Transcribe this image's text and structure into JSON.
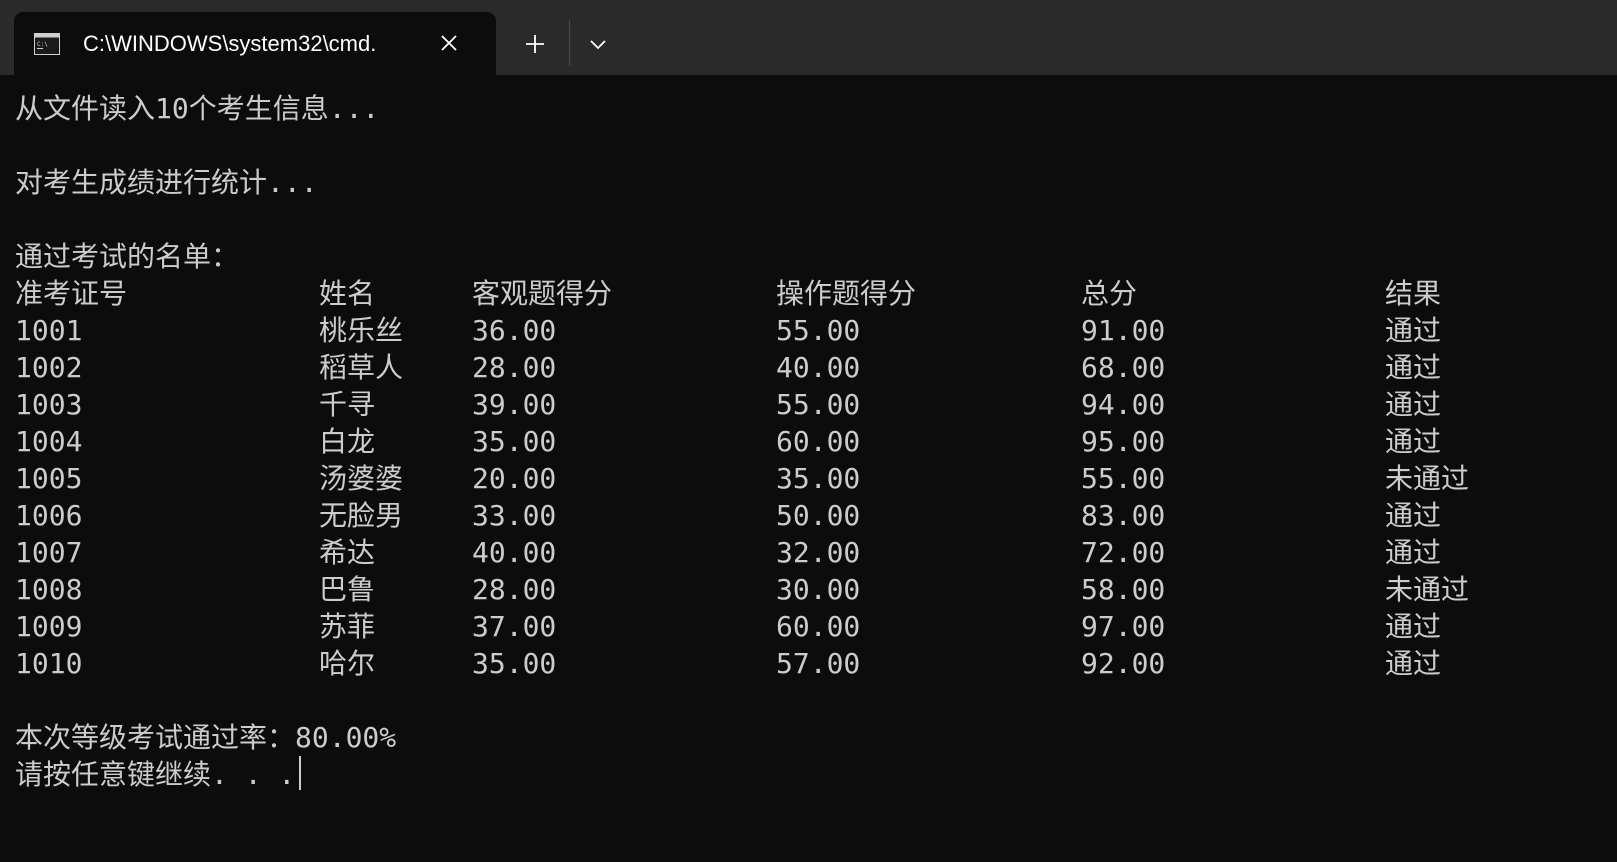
{
  "window": {
    "tab_title": "C:\\WINDOWS\\system32\\cmd.",
    "icons": [
      "cmd-icon",
      "close-icon",
      "plus-icon",
      "chevron-down-icon"
    ]
  },
  "console": {
    "line1": "从文件读入10个考生信息...",
    "line2": "对考生成绩进行统计...",
    "list_title": "通过考试的名单：",
    "headers": [
      "准考证号",
      "姓名",
      "客观题得分",
      "操作题得分",
      "总分",
      "结果"
    ],
    "rows": [
      [
        "1001",
        "桃乐丝",
        "36.00",
        "55.00",
        "91.00",
        "通过"
      ],
      [
        "1002",
        "稻草人",
        "28.00",
        "40.00",
        "68.00",
        "通过"
      ],
      [
        "1003",
        "千寻",
        "39.00",
        "55.00",
        "94.00",
        "通过"
      ],
      [
        "1004",
        "白龙",
        "35.00",
        "60.00",
        "95.00",
        "通过"
      ],
      [
        "1005",
        "汤婆婆",
        "20.00",
        "35.00",
        "55.00",
        "未通过"
      ],
      [
        "1006",
        "无脸男",
        "33.00",
        "50.00",
        "83.00",
        "通过"
      ],
      [
        "1007",
        "希达",
        "40.00",
        "32.00",
        "72.00",
        "通过"
      ],
      [
        "1008",
        "巴鲁",
        "28.00",
        "30.00",
        "58.00",
        "未通过"
      ],
      [
        "1009",
        "苏菲",
        "37.00",
        "60.00",
        "97.00",
        "通过"
      ],
      [
        "1010",
        "哈尔",
        "35.00",
        "57.00",
        "92.00",
        "通过"
      ]
    ],
    "pass_rate": "本次等级考试通过率：80.00%",
    "prompt": "请按任意键继续. . ."
  },
  "colors": {
    "background": "#0c0c0c",
    "titlebar": "#2b2b2b",
    "text": "#cccccc"
  }
}
